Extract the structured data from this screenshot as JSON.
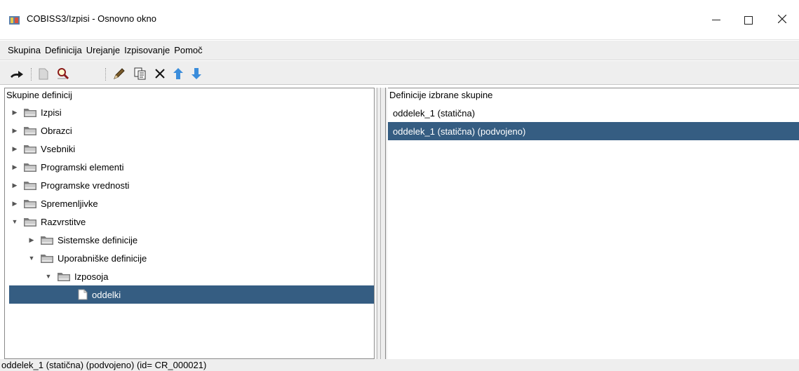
{
  "window": {
    "title": "COBISS3/Izpisi - Osnovno okno",
    "minimize_glyph": "—",
    "maximize_glyph": "☐",
    "close_glyph": "✕"
  },
  "menu": [
    "Skupina",
    "Definicija",
    "Urejanje",
    "Izpisovanje",
    "Pomoč"
  ],
  "toolbar": {
    "icons": [
      "exit-icon",
      "new-document-icon",
      "find-icon",
      "edit-pencil-icon",
      "copy-icon",
      "delete-icon",
      "move-up-icon",
      "move-down-icon"
    ],
    "colors": {
      "arrow": "#3b8ddb",
      "pencil": "#7a5a2a"
    }
  },
  "left_panel": {
    "header": "Skupine definicij",
    "tree": [
      {
        "label": "Izpisi",
        "level": 0,
        "expander": "▶",
        "kind": "folder"
      },
      {
        "label": "Obrazci",
        "level": 0,
        "expander": "▶",
        "kind": "folder"
      },
      {
        "label": "Vsebniki",
        "level": 0,
        "expander": "▶",
        "kind": "folder"
      },
      {
        "label": "Programski elementi",
        "level": 0,
        "expander": "▶",
        "kind": "folder"
      },
      {
        "label": "Programske vrednosti",
        "level": 0,
        "expander": "▶",
        "kind": "folder"
      },
      {
        "label": "Spremenljivke",
        "level": 0,
        "expander": "▶",
        "kind": "folder"
      },
      {
        "label": "Razvrstitve",
        "level": 0,
        "expander": "▼",
        "kind": "folder"
      },
      {
        "label": "Sistemske definicije",
        "level": 1,
        "expander": "▶",
        "kind": "folder"
      },
      {
        "label": "Uporabniške definicije",
        "level": 1,
        "expander": "▼",
        "kind": "folder"
      },
      {
        "label": "Izposoja",
        "level": 2,
        "expander": "▼",
        "kind": "folder"
      },
      {
        "label": "oddelki",
        "level": 3,
        "expander": "",
        "kind": "document",
        "selected": true
      }
    ]
  },
  "right_panel": {
    "header": "Definicije izbrane skupine",
    "items": [
      {
        "label": "oddelek_1 (statična)",
        "selected": false
      },
      {
        "label": "oddelek_1 (statična) (podvojeno)",
        "selected": true
      }
    ]
  },
  "status_bar": "oddelek_1 (statična) (podvojeno) (id= CR_000021)",
  "colors": {
    "selection": "#355d82",
    "chrome": "#eeeeee",
    "folder": "#7b7b7b"
  }
}
